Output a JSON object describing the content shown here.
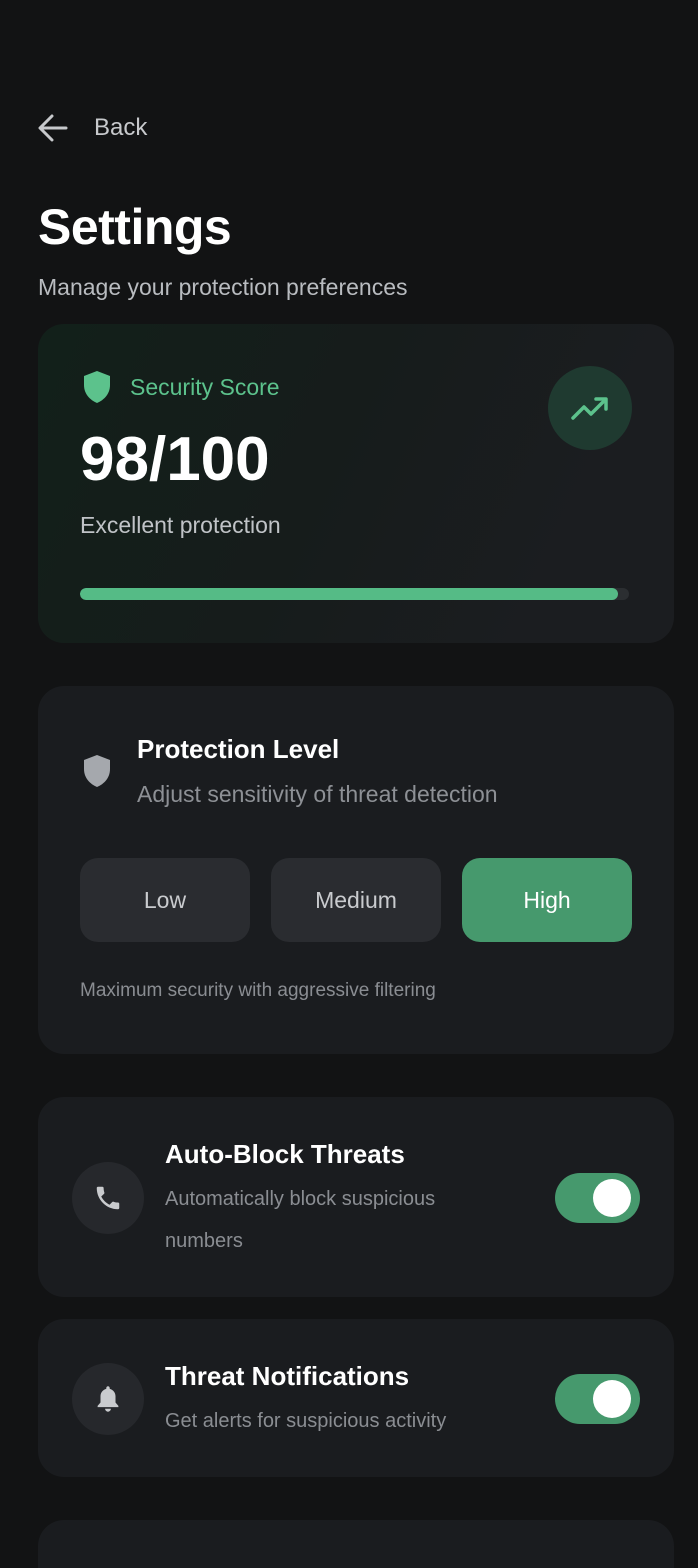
{
  "nav": {
    "back_label": "Back"
  },
  "header": {
    "title": "Settings",
    "subtitle": "Manage your protection preferences"
  },
  "security_score": {
    "label": "Security Score",
    "value": "98/100",
    "description": "Excellent protection",
    "progress": 0.98,
    "icon": "shield-icon",
    "action_icon": "trending-up-icon"
  },
  "protection_level": {
    "title": "Protection Level",
    "description": "Adjust sensitivity of threat detection",
    "icon": "shield-icon",
    "options": [
      "Low",
      "Medium",
      "High"
    ],
    "selected": "High",
    "note": "Maximum security with aggressive filtering"
  },
  "settings": [
    {
      "title": "Auto-Block Threats",
      "description": "Automatically block suspicious numbers",
      "icon": "phone-icon",
      "enabled": true
    },
    {
      "title": "Threat Notifications",
      "description": "Get alerts for suspicious activity",
      "icon": "bell-icon",
      "enabled": true
    }
  ],
  "colors": {
    "background": "#121314",
    "card": "#1a1c1f",
    "accent": "#46996d",
    "accent_text": "#5cc28c"
  }
}
